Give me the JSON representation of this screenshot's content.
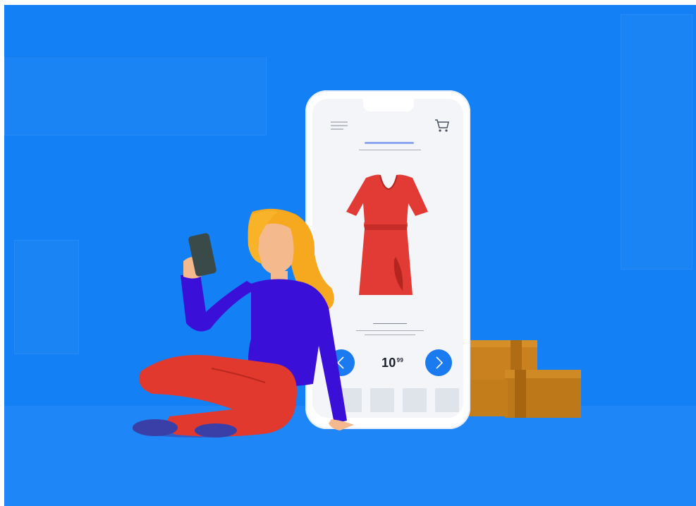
{
  "illustration": {
    "subject": "woman-shopping-online",
    "colors": {
      "background": "#1480f5",
      "floor": "#1f86f7",
      "phone_body": "#ffffff",
      "screen": "#f3f5f9",
      "accent_blue": "#1a7af0",
      "dress_red": "#e23a34",
      "hair_orange": "#f6a81f",
      "shirt_purple": "#3a10d8",
      "pants_red": "#e1392e",
      "skin": "#f4b98c",
      "box_brown": "#c8811e"
    }
  },
  "app": {
    "header": {
      "menu_icon": "hamburger-menu-icon",
      "cart_icon": "shopping-cart-icon"
    },
    "product": {
      "image": "red-dress",
      "price_main": "10",
      "price_cents": "99"
    },
    "nav": {
      "prev_icon": "chevron-left-icon",
      "next_icon": "chevron-right-icon"
    },
    "thumbnails": 4
  }
}
